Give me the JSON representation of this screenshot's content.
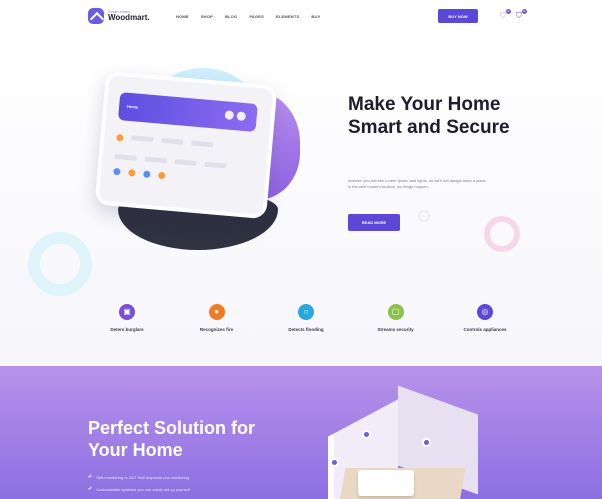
{
  "header": {
    "logo_small": "Smart Home",
    "logo_name": "Woodmart.",
    "nav": [
      "HOME",
      "SHOP",
      "BLOG",
      "PAGES",
      "ELEMENTS",
      "BUY"
    ],
    "cta": "BUY NOW",
    "wishlist_count": "0",
    "cart_count": "0"
  },
  "device_screen": {
    "label": "Home"
  },
  "hero": {
    "title": "Make Your Home Smart and Secure",
    "text": "Answer, you will see Lorem Ipsum and lights, as we'll will always have a place in the web modern toolbox, as things happen.",
    "button": "READ MORE"
  },
  "features": [
    {
      "label": "Deters burglars",
      "icon": "lock-icon",
      "color": "#7a4fd6"
    },
    {
      "label": "Recognizes fire",
      "icon": "flame-icon",
      "color": "#f07b26"
    },
    {
      "label": "Detects flooding",
      "icon": "drop-icon",
      "color": "#2aa8d8"
    },
    {
      "label": "Streams security",
      "icon": "camera-icon",
      "color": "#8bc34a"
    },
    {
      "label": "Controls appliances",
      "icon": "grid-icon",
      "color": "#5b48d6"
    }
  ],
  "solution": {
    "title": "Perfect Solution for Your Home",
    "checks": [
      "Self-monitoring or 24/7 Self response pro-monitoring",
      "Customizable systems you can easily set up yourself"
    ]
  },
  "colors": {
    "accent": "#5b48d6",
    "section_purple": "#8c6fe2"
  }
}
